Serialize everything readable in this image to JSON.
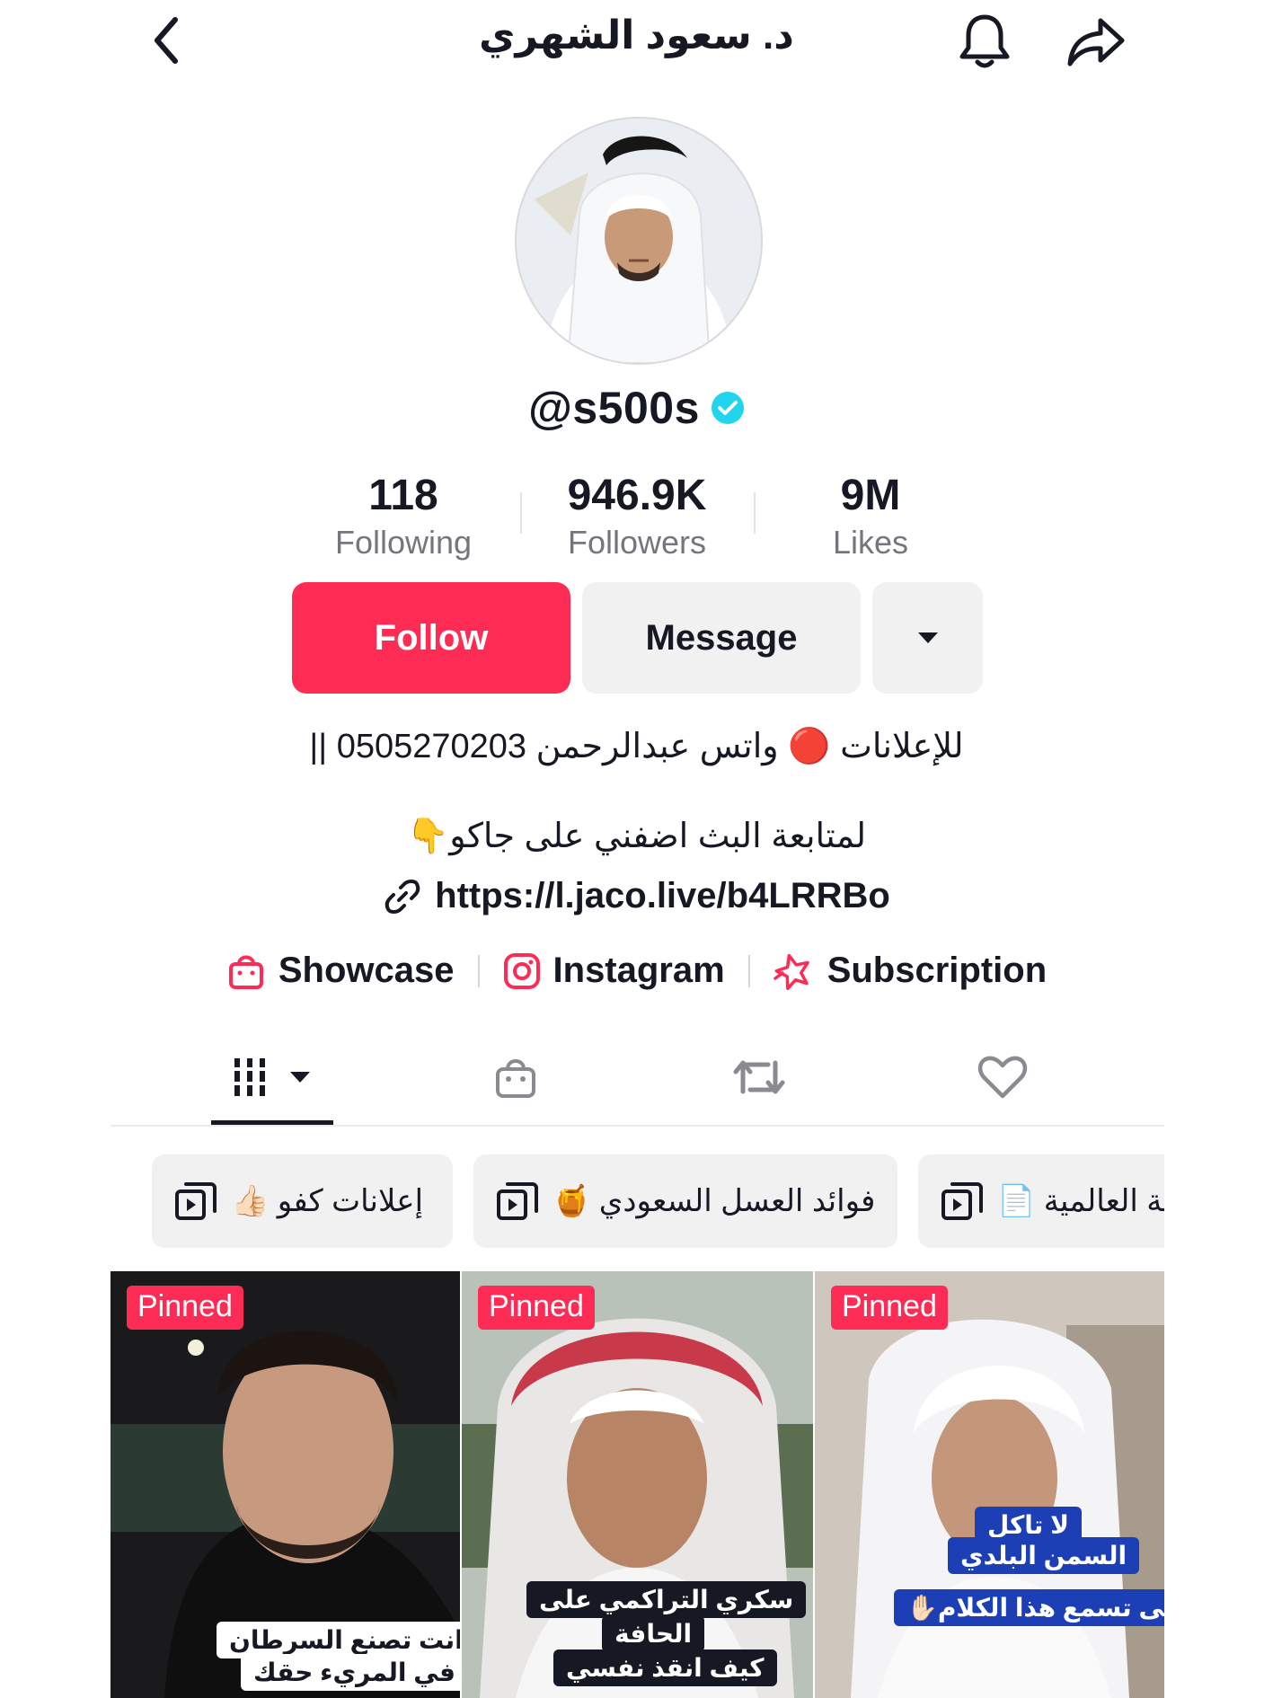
{
  "header": {
    "title": "د. سعود الشهري",
    "back_icon": "chevron-left-icon",
    "bell_icon": "bell-icon",
    "share_icon": "share-icon"
  },
  "profile": {
    "username": "@s500s",
    "verified": true
  },
  "stats": [
    {
      "value": "118",
      "label": "Following"
    },
    {
      "value": "946.9K",
      "label": "Followers"
    },
    {
      "value": "9M",
      "label": "Likes"
    }
  ],
  "actions": {
    "follow_label": "Follow",
    "message_label": "Message"
  },
  "bio": {
    "line1": "للإعلانات 🔴 واتس عبدالرحمن 0505270203 ||",
    "line2": "لمتابعة البث اضفني على جاكو👇",
    "link": "https://l.jaco.live/b4LRRBo"
  },
  "links": [
    {
      "label": "Showcase",
      "icon": "shopping-bag-icon"
    },
    {
      "label": "Instagram",
      "icon": "instagram-icon"
    },
    {
      "label": "Subscription",
      "icon": "subscription-star-icon"
    }
  ],
  "tabs": [
    {
      "name": "videos",
      "icon": "grid-icon"
    },
    {
      "name": "shop",
      "icon": "shopping-bag-icon"
    },
    {
      "name": "reposts",
      "icon": "repost-icon"
    },
    {
      "name": "liked",
      "icon": "heart-icon"
    }
  ],
  "playlists": [
    {
      "label": "إعلانات كفو 👍🏻"
    },
    {
      "label": "فوائد العسل السعودي 🍯"
    },
    {
      "label": "ية العالمية 📄"
    }
  ],
  "videos": [
    {
      "badge": "Pinned",
      "captions": [
        "انت تصنع السرطان",
        "في المريء حقك"
      ]
    },
    {
      "badge": "Pinned",
      "captions": [
        "سكري التراكمي على",
        "الحافة",
        "كيف انقذ نفسي"
      ]
    },
    {
      "badge": "Pinned",
      "captions": [
        "لا تاكل",
        "السمن البلدي",
        "حتى تسمع هذا الكلام✋🏻"
      ]
    }
  ],
  "colors": {
    "accent": "#fe2c55",
    "verified": "#20d5ec",
    "text": "#161823",
    "muted": "#75767d"
  }
}
